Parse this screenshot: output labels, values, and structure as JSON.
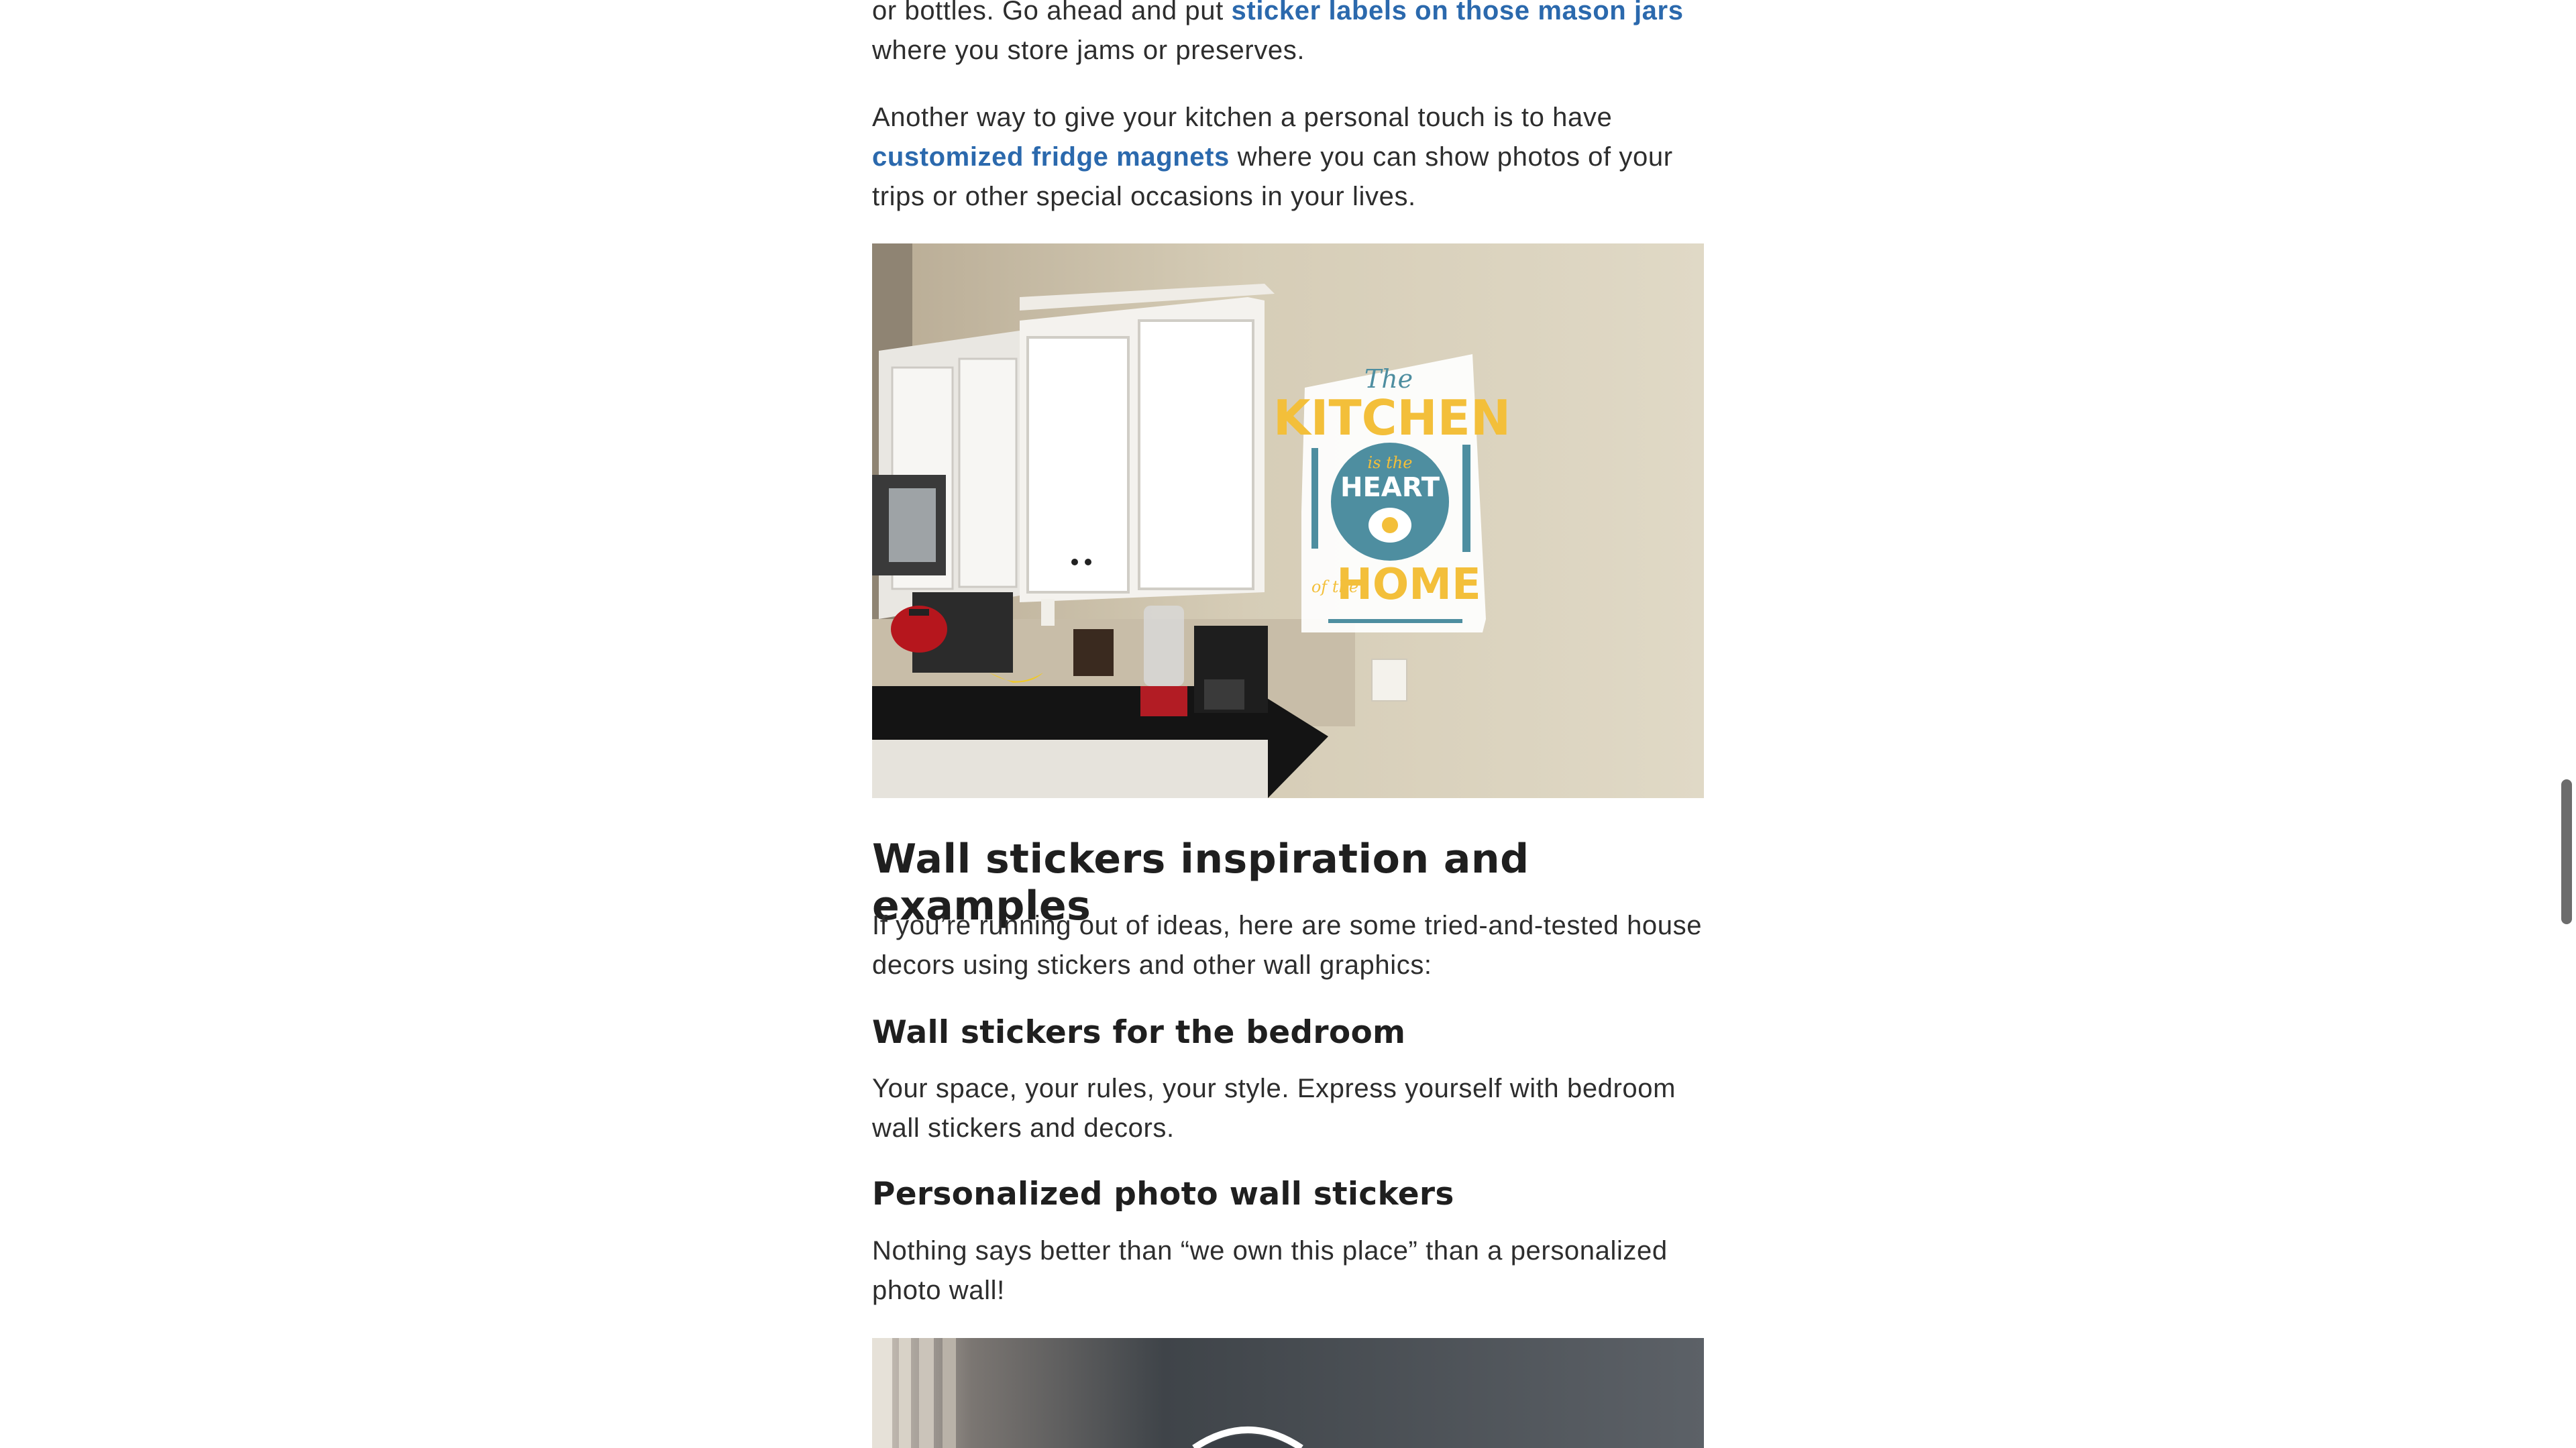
{
  "intro": {
    "line_prefix": "or bottles. Go ahead and put ",
    "link_text": "sticker labels on those mason jars",
    "line_suffix": " where you store jams or preserves."
  },
  "magnets": {
    "prefix": "Another way to give your kitchen a personal touch is to have ",
    "link_text": "customized fridge magnets",
    "suffix": " where you can show photos of your trips or other special occasions in your lives."
  },
  "kitchen_decal": {
    "line1": "The",
    "line2": "KITCHEN",
    "line3": "is the",
    "line4": "HEART",
    "line5": "of the",
    "line6": "HOME"
  },
  "section": {
    "title": "Wall stickers inspiration and examples",
    "intro": "If you’re running out of ideas, here are some tried-and-tested house decors using stickers and other wall graphics:"
  },
  "bedroom": {
    "title": "Wall stickers for the bedroom",
    "text": "Your space, your rules, your style. Express yourself with bedroom wall stickers and decors."
  },
  "photo_wall": {
    "title": "Personalized photo wall stickers",
    "text": "Nothing says better than “we own this place” than a personalized photo wall!"
  },
  "colors": {
    "link": "#2b69ad",
    "text": "#2d2d2d",
    "decal_yellow": "#f3bf3a",
    "decal_teal": "#4e8ea0"
  }
}
